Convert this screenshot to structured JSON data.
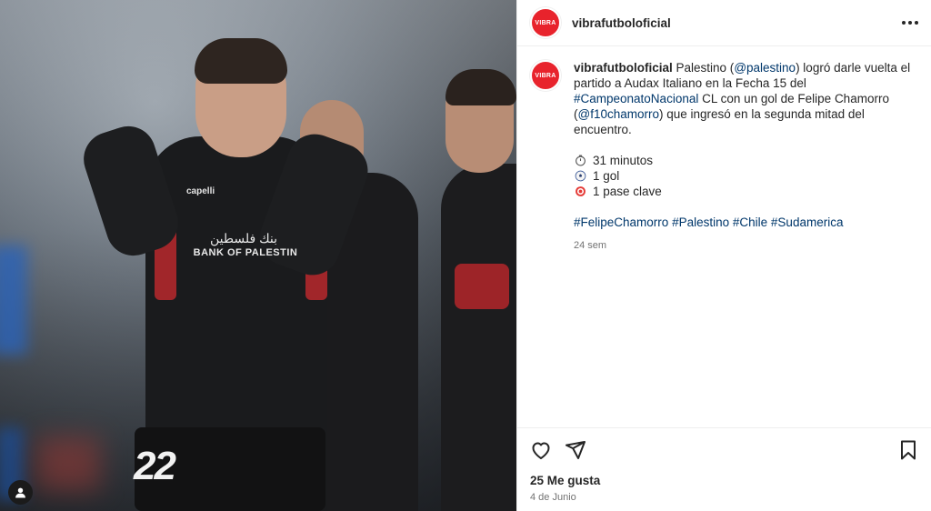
{
  "photo": {
    "jersey_brand": "capelli",
    "jersey_sponsor_arabic": "بنك فلسطين",
    "jersey_sponsor": "BANK OF PALESTIN",
    "jersey_number": "22"
  },
  "header": {
    "avatar_text": "VIBRA",
    "username": "vibrafutboloficial"
  },
  "caption": {
    "avatar_text": "VIBRA",
    "username": "vibrafutboloficial",
    "text_1": " Palestino (",
    "mention_palestino": "@palestino",
    "text_2": ") logró darle vuelta el partido a Audax Italiano en la Fecha 15 del ",
    "hashtag_campeonato": "#CampeonatoNacional",
    "text_3": " CL con un gol de Felipe Chamorro (",
    "mention_chamorro": "@f10chamorro",
    "text_4": ") que ingresó en la segunda mitad del encuentro.",
    "stats": [
      {
        "icon": "stopwatch-icon",
        "label": "31 minutos"
      },
      {
        "icon": "soccer-ball-icon",
        "label": "1 gol"
      },
      {
        "icon": "target-icon",
        "label": "1 pase clave"
      }
    ],
    "hashtags": [
      "#FelipeChamorro",
      "#Palestino",
      "#Chile",
      "#Sudamerica"
    ],
    "age": "24 sem"
  },
  "footer": {
    "likes": "25 Me gusta",
    "date": "4 de Junio"
  },
  "colors": {
    "brand_red": "#e8232c",
    "link_blue": "#00376b",
    "muted_gray": "#737373"
  }
}
